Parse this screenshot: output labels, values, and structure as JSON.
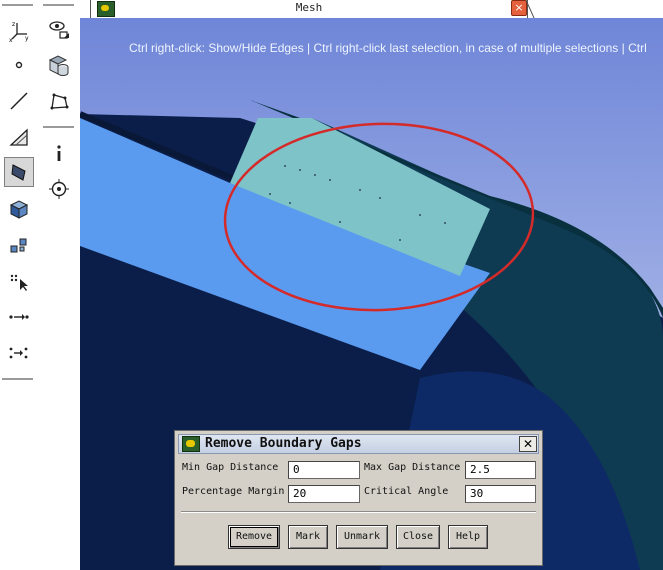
{
  "window": {
    "tab_title": "Mesh",
    "tab_close": "×"
  },
  "viewport": {
    "hint_text": "Ctrl right-click: Show/Hide Edges | Ctrl right-click last selection, in case of multiple selections | Ctrl",
    "colors": {
      "background_top": "#6f86d8",
      "background_bottom": "#c8d2f0",
      "dark_body": "#0b1e4a",
      "highlight_face": "#5b9bef",
      "selected_patch": "#7dc3c8",
      "outline_circle": "#d42a2a"
    }
  },
  "toolbar": {
    "icons": [
      "axes-icon",
      "view-icon",
      "point-icon",
      "cylinder-icon",
      "line-icon",
      "polyline-icon",
      "angle-icon",
      "info-icon",
      "face-select-icon",
      "target-icon",
      "cube-icon",
      "multi-select-icon",
      "pick-icon",
      "arrow-flow-icon",
      "merge-icon"
    ]
  },
  "dialog": {
    "title": "Remove Boundary Gaps",
    "close": "✕",
    "fields": {
      "min_gap_label": "Min Gap Distance",
      "min_gap_value": "0",
      "max_gap_label": "Max Gap Distance",
      "max_gap_value": "2.5",
      "percentage_margin_label": "Percentage Margin",
      "percentage_margin_value": "20",
      "critical_angle_label": "Critical Angle",
      "critical_angle_value": "30"
    },
    "buttons": {
      "remove": "Remove",
      "mark": "Mark",
      "unmark": "Unmark",
      "close": "Close",
      "help": "Help"
    }
  }
}
